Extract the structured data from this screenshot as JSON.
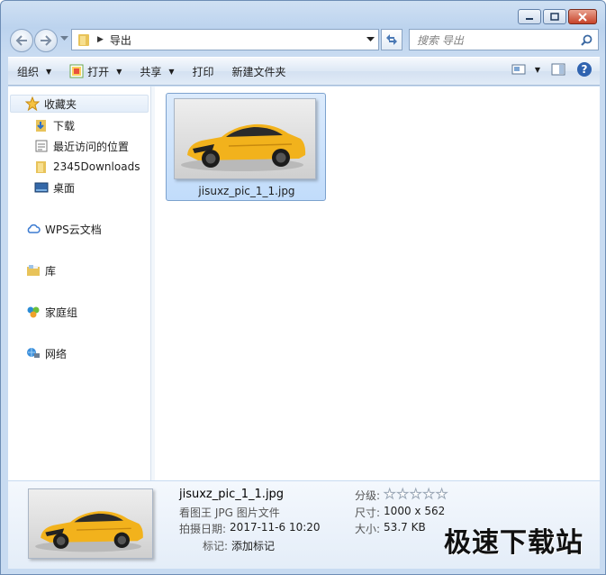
{
  "window": {
    "caption": {
      "minimize": "minimize",
      "maximize": "maximize",
      "close": "close"
    }
  },
  "address": {
    "breadcrumb": [
      "导出"
    ],
    "search_placeholder": "搜索 导出"
  },
  "toolbar": {
    "organize": "组织",
    "open": "打开",
    "share": "共享",
    "print": "打印",
    "new_folder": "新建文件夹"
  },
  "nav": {
    "favorites": "收藏夹",
    "downloads": "下载",
    "recent": "最近访问的位置",
    "downloads2345": "2345Downloads",
    "desktop": "桌面",
    "wps": "WPS云文档",
    "libraries": "库",
    "homegroup": "家庭组",
    "network": "网络"
  },
  "files": [
    {
      "name": "jisuxz_pic_1_1.jpg"
    }
  ],
  "details": {
    "title": "jisuxz_pic_1_1.jpg",
    "type": "看图王 JPG 图片文件",
    "date_label": "拍摄日期:",
    "date_value": "2017-11-6 10:20",
    "tags_label": "标记:",
    "tags_value": "添加标记",
    "rating_label": "分级:",
    "rating": 0,
    "size_dims_label": "尺寸:",
    "size_dims_value": "1000 x 562",
    "filesize_label": "大小:",
    "filesize_value": "53.7 KB"
  },
  "watermark": "极速下载站",
  "colors": {
    "accent": "#7da2ce",
    "car_body": "#f2b21c"
  }
}
